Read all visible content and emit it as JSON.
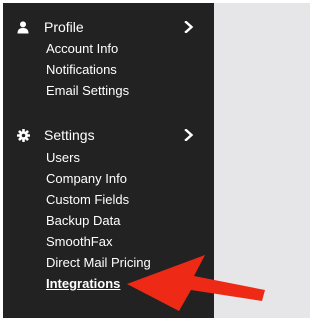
{
  "colors": {
    "sidebar_bg": "#222222",
    "content_bg": "#e6e6e8",
    "text": "#ffffff",
    "annotation_arrow": "#ee2a17"
  },
  "sidebar": {
    "profile": {
      "icon": "user-icon",
      "label": "Profile",
      "items": [
        {
          "label": "Account Info"
        },
        {
          "label": "Notifications"
        },
        {
          "label": "Email Settings"
        }
      ]
    },
    "settings": {
      "icon": "gear-icon",
      "label": "Settings",
      "items": [
        {
          "label": "Users"
        },
        {
          "label": "Company Info"
        },
        {
          "label": "Custom Fields"
        },
        {
          "label": "Backup Data"
        },
        {
          "label": "SmoothFax"
        },
        {
          "label": "Direct Mail Pricing"
        },
        {
          "label": "Integrations",
          "active": true
        }
      ]
    }
  },
  "annotation": {
    "type": "arrow",
    "points_to": "Integrations"
  }
}
